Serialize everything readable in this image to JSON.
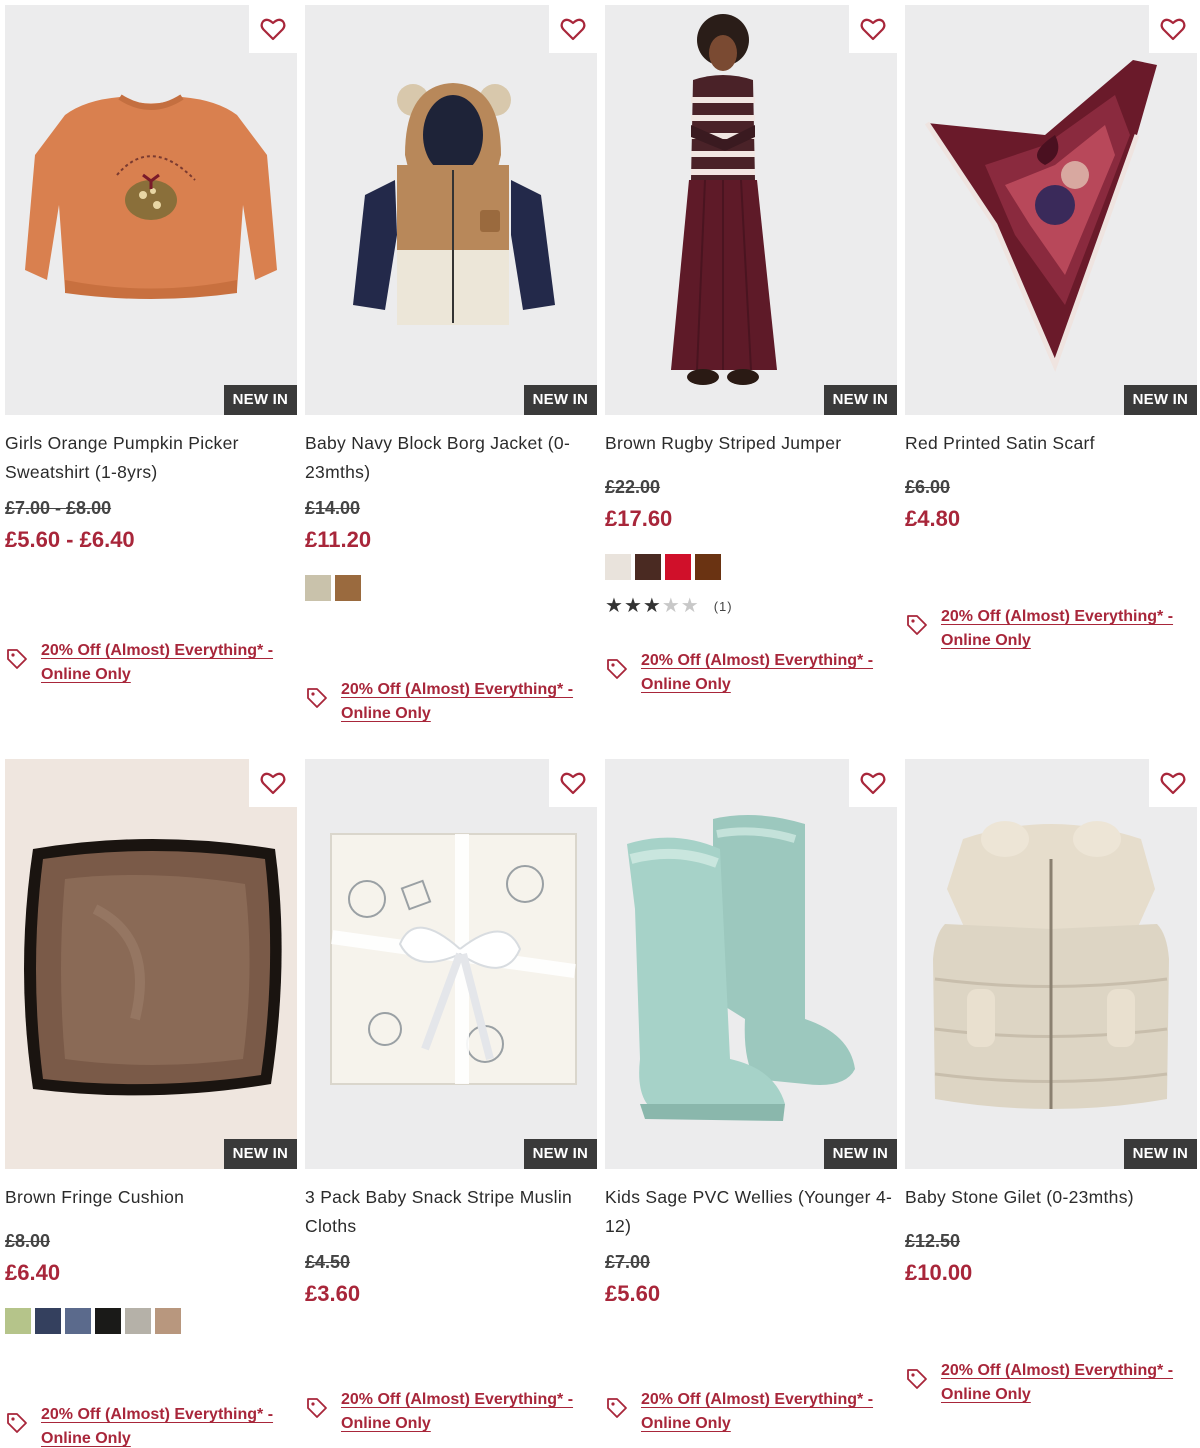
{
  "colors": {
    "price_accent": "#a8263a",
    "badge_bg": "#3a3a3a"
  },
  "wishlist_icon": "heart-outline-icon",
  "promo_icon": "price-tag-icon",
  "products": [
    {
      "title": "Girls Orange Pumpkin Picker Sweatshirt (1-8yrs)",
      "badge": "NEW IN",
      "was_price": "£7.00 - £8.00",
      "now_price": "£5.60 - £6.40",
      "promo": "20% Off (Almost) Everything* - Online Only"
    },
    {
      "title": "Baby Navy Block Borg Jacket (0-23mths)",
      "badge": "NEW IN",
      "was_price": "£14.00",
      "now_price": "£11.20",
      "swatches": [
        "#c9c2ab",
        "#9a6a3e"
      ],
      "promo": "20% Off (Almost) Everything* - Online Only"
    },
    {
      "title": "Brown Rugby Striped Jumper",
      "badge": "NEW IN",
      "was_price": "£22.00",
      "now_price": "£17.60",
      "swatches": [
        "#e9e3dc",
        "#4a2a22",
        "#d0102a",
        "#6a3312"
      ],
      "rating": {
        "stars": 3,
        "max": 5,
        "count": "(1)"
      },
      "promo": "20% Off (Almost) Everything* - Online Only"
    },
    {
      "title": "Red Printed Satin Scarf",
      "badge": "NEW IN",
      "was_price": "£6.00",
      "now_price": "£4.80",
      "promo": "20% Off (Almost) Everything* - Online Only"
    },
    {
      "title": "Brown Fringe Cushion",
      "badge": "NEW IN",
      "was_price": "£8.00",
      "now_price": "£6.40",
      "swatches": [
        "#b5c48a",
        "#34405e",
        "#5b6a8c",
        "#1a1a18",
        "#b5b1a8",
        "#b8977e"
      ],
      "promo": "20% Off (Almost) Everything* - Online Only"
    },
    {
      "title": "3 Pack Baby Snack Stripe Muslin Cloths",
      "badge": "NEW IN",
      "was_price": "£4.50",
      "now_price": "£3.60",
      "promo": "20% Off (Almost) Everything* - Online Only"
    },
    {
      "title": "Kids Sage PVC Wellies (Younger 4-12)",
      "badge": "NEW IN",
      "was_price": "£7.00",
      "now_price": "£5.60",
      "promo": "20% Off (Almost) Everything* - Online Only"
    },
    {
      "title": "Baby Stone Gilet (0-23mths)",
      "badge": "NEW IN",
      "was_price": "£12.50",
      "now_price": "£10.00",
      "promo": "20% Off (Almost) Everything* - Online Only"
    }
  ]
}
